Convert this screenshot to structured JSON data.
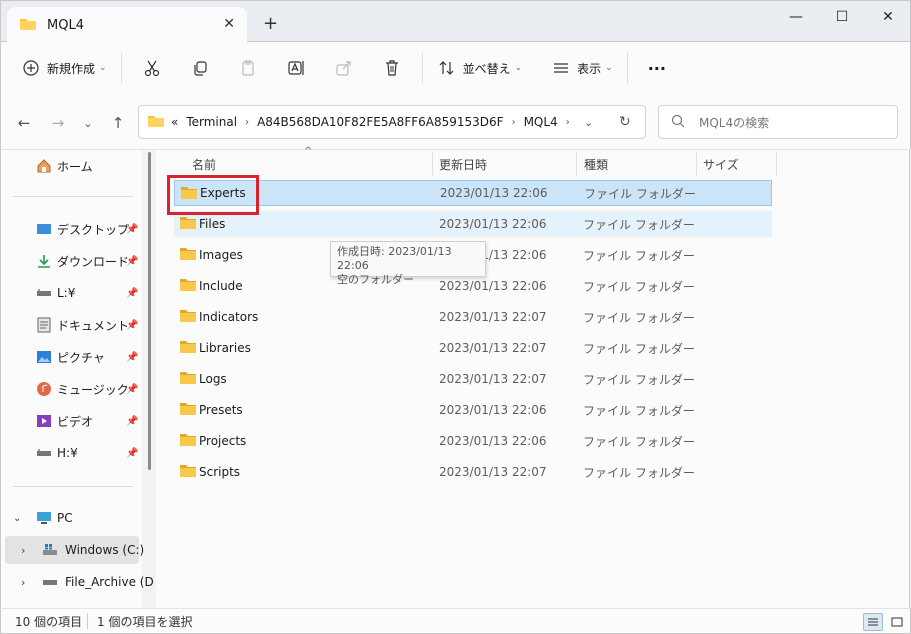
{
  "window": {
    "tab_title": "MQL4",
    "new_tab": "+",
    "close_tab": "✕",
    "minimize": "—",
    "maximize": "☐",
    "close": "✕"
  },
  "toolbar": {
    "new_label": "新規作成",
    "sort_label": "並べ替え",
    "view_label": "表示",
    "more": "···"
  },
  "address": {
    "overflow": "«",
    "crumbs": [
      "Terminal",
      "A84B568DA10F82FE5A8FF6A859153D6F",
      "MQL4"
    ]
  },
  "search": {
    "placeholder": "MQL4の検索"
  },
  "sidebar": {
    "home": "ホーム",
    "quick": [
      {
        "label": "デスクトップ"
      },
      {
        "label": "ダウンロード"
      },
      {
        "label": "L:¥"
      },
      {
        "label": "ドキュメント"
      },
      {
        "label": "ピクチャ"
      },
      {
        "label": "ミュージック"
      },
      {
        "label": "ビデオ"
      },
      {
        "label": "H:¥"
      }
    ],
    "pc": "PC",
    "drives": [
      {
        "label": "Windows (C:)"
      },
      {
        "label": "File_Archive (D"
      }
    ]
  },
  "columns": {
    "name": "名前",
    "date": "更新日時",
    "type": "種類",
    "size": "サイズ"
  },
  "files": [
    {
      "name": "Experts",
      "date": "2023/01/13 22:06",
      "type": "ファイル フォルダー"
    },
    {
      "name": "Files",
      "date": "2023/01/13 22:06",
      "type": "ファイル フォルダー"
    },
    {
      "name": "Images",
      "date": "2023/01/13 22:06",
      "type": "ファイル フォルダー"
    },
    {
      "name": "Include",
      "date": "2023/01/13 22:06",
      "type": "ファイル フォルダー"
    },
    {
      "name": "Indicators",
      "date": "2023/01/13 22:07",
      "type": "ファイル フォルダー"
    },
    {
      "name": "Libraries",
      "date": "2023/01/13 22:07",
      "type": "ファイル フォルダー"
    },
    {
      "name": "Logs",
      "date": "2023/01/13 22:07",
      "type": "ファイル フォルダー"
    },
    {
      "name": "Presets",
      "date": "2023/01/13 22:06",
      "type": "ファイル フォルダー"
    },
    {
      "name": "Projects",
      "date": "2023/01/13 22:06",
      "type": "ファイル フォルダー"
    },
    {
      "name": "Scripts",
      "date": "2023/01/13 22:07",
      "type": "ファイル フォルダー"
    }
  ],
  "tooltip": {
    "line1": "作成日時: 2023/01/13 22:06",
    "line2": "空のフォルダー"
  },
  "status": {
    "count": "10 個の項目",
    "selected": "1 個の項目を選択"
  },
  "colors": {
    "folder": "#f4c245",
    "selection": "#cce4f7",
    "annotation": "#d9232d"
  }
}
